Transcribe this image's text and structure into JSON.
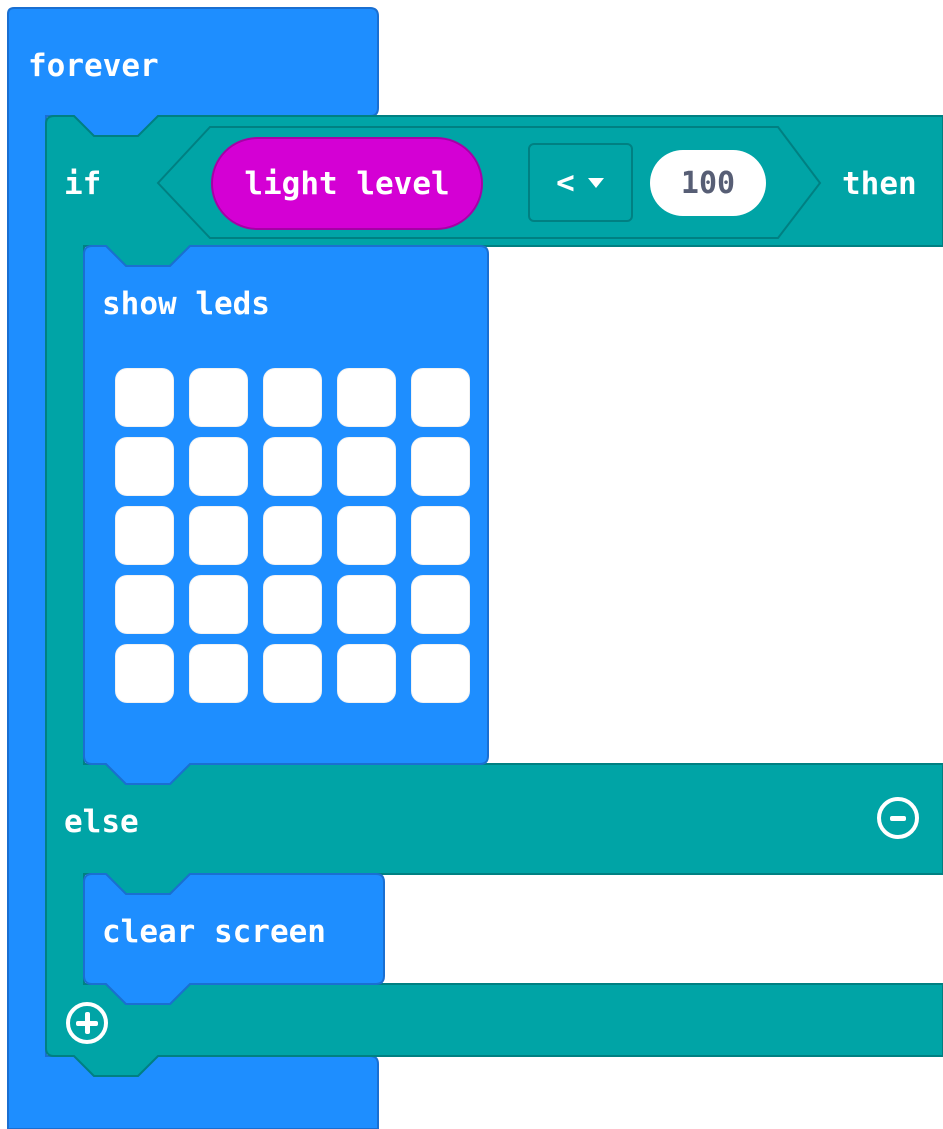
{
  "colors": {
    "loops_blue": "#1e8eff",
    "loops_blue_border": "#1a6fd1",
    "logic_teal": "#00a4a6",
    "logic_teal_border": "#008082",
    "input_magenta": "#d400d4",
    "input_magenta_border": "#a600a6",
    "led_off": "#ffffff",
    "field_text": "#575e75"
  },
  "forever_block": {
    "label": "forever"
  },
  "if_block": {
    "if_label": "if",
    "then_label": "then",
    "else_label": "else",
    "remove_else_icon": "minus-circle-icon",
    "add_else_icon": "plus-circle-icon"
  },
  "condition": {
    "sensor_label": "light level",
    "operator": "<",
    "dropdown_icon": "triangle-down-icon",
    "value": "100"
  },
  "show_leds_block": {
    "label": "show leds",
    "leds": [
      [
        false,
        false,
        false,
        false,
        false
      ],
      [
        false,
        false,
        false,
        false,
        false
      ],
      [
        false,
        false,
        false,
        false,
        false
      ],
      [
        false,
        false,
        false,
        false,
        false
      ],
      [
        false,
        false,
        false,
        false,
        false
      ]
    ]
  },
  "clear_screen_block": {
    "label": "clear screen"
  }
}
